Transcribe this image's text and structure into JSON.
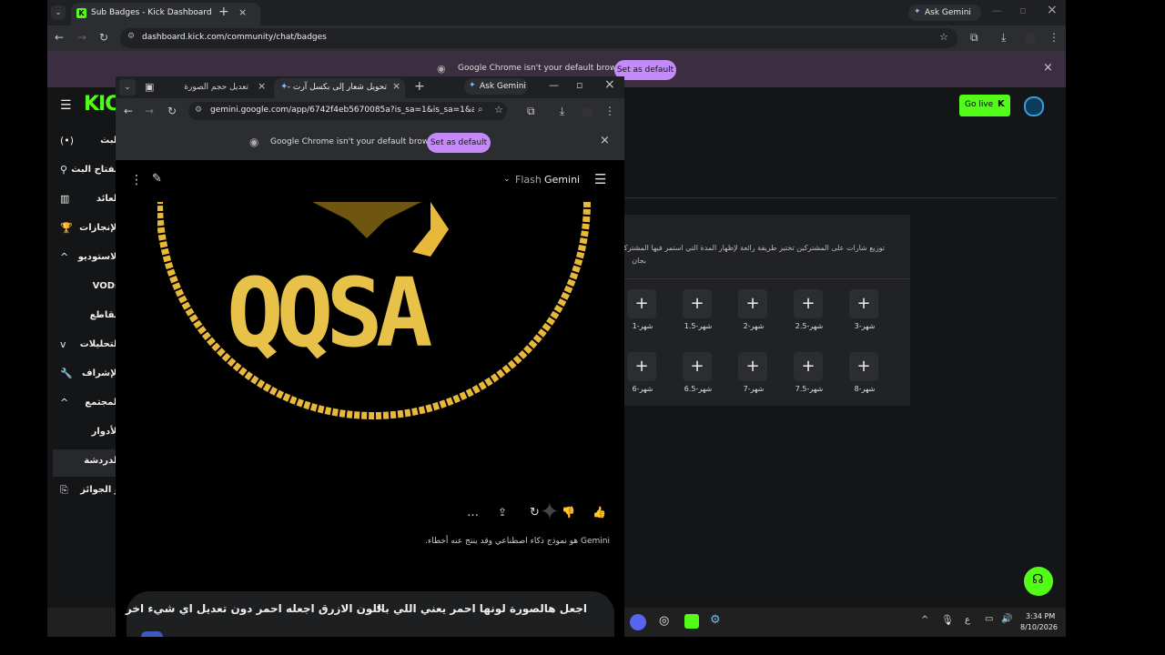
{
  "back_window": {
    "tab_title": "Sub Badges - Kick Dashboard",
    "ask_gemini": "Ask Gemini",
    "url": "dashboard.kick.com/community/chat/badges",
    "infobar_text": "Google Chrome isn't your default browser",
    "infobar_button": "Set as default",
    "brand": "KIC",
    "go_live": "Go live",
    "badges_desc_line1": "توزيع شارات على المشتركين تختبر طريقة رائعة لإظهار المدة التي استمر فيها المشتركون ب",
    "badges_desc_line2": "بجان",
    "badges": [
      {
        "label": "شهر-1"
      },
      {
        "label": "شهر-1.5"
      },
      {
        "label": "شهر-2"
      },
      {
        "label": "شهر-2.5"
      },
      {
        "label": "شهر-3"
      },
      {
        "label": "شهر-6"
      },
      {
        "label": "شهر-6.5"
      },
      {
        "label": "شهر-7"
      },
      {
        "label": "شهر-7.5"
      },
      {
        "label": "شهر-8"
      }
    ],
    "sidebar": [
      {
        "label": "البث",
        "icon": "(•)"
      },
      {
        "label": "مفتاح البث",
        "icon": "⚲"
      },
      {
        "label": "العائد",
        "icon": "▥"
      },
      {
        "label": "الإنجازات",
        "icon": "🏆"
      },
      {
        "label": "الاستوديو",
        "icon": "^"
      },
      {
        "label": "VODs",
        "icon": ""
      },
      {
        "label": "مقاطع",
        "icon": ""
      },
      {
        "label": "التحليلات",
        "icon": "v"
      },
      {
        "label": "الإشراف",
        "icon": "🔧"
      },
      {
        "label": "المجتمع",
        "icon": "^"
      },
      {
        "label": "الأدوار",
        "icon": ""
      },
      {
        "label": "الدردشة",
        "icon": ""
      },
      {
        "label": "و الجوائز",
        "icon": "⎘"
      }
    ]
  },
  "front_window": {
    "tab1_title": "تعديل حجم الصورة",
    "tab2_title": "تحويل شعار إلى بكسل آرت - ",
    "ask_gemini": "Ask Gemini",
    "url": "gemini.google.com/app/6742f4eb5670085a?is_sa=1&is_sa=1&and...",
    "infobar_text": "Google Chrome isn't your default browser",
    "infobar_button": "Set as default",
    "model_label": "Flash",
    "app_name": "Gemini",
    "logo_text": "QQSA",
    "disclaimer": "Gemini هو نموذج ذكاء اصطناعي وقد ينتج عنه أخطاء.",
    "prompt_text": "اجعل هالصورة لونها احمر يعني اللي باللون الازرق اجعله احمر دون تعديل اي شيء اخر"
  },
  "taskbar": {
    "time": "3:34 PM",
    "date": "8/10/2026",
    "lang": "ع"
  },
  "colors": {
    "kick_green": "#53fc18",
    "gold": "#e8b83a",
    "pill": "#c58af9"
  }
}
